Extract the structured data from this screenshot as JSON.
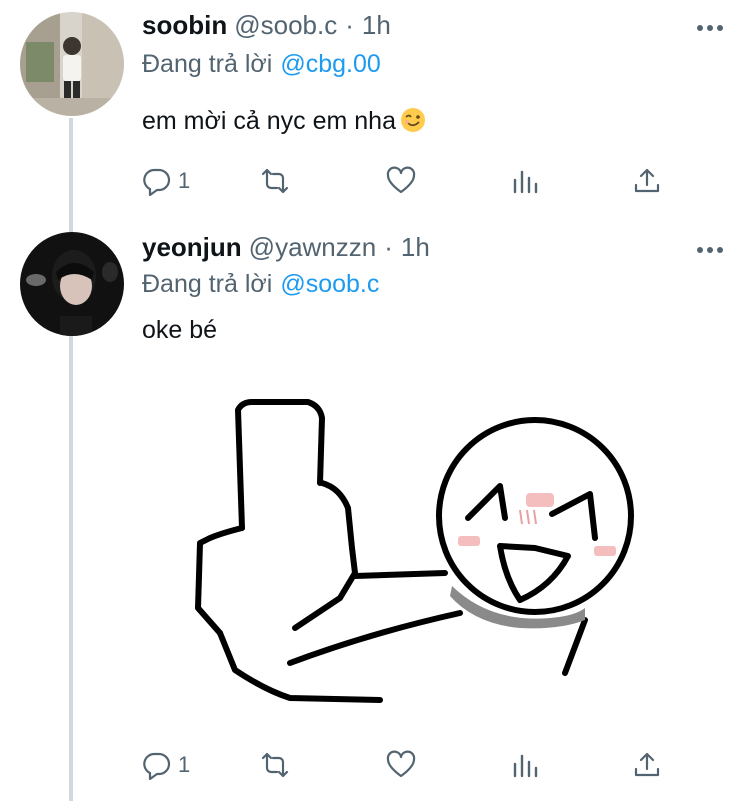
{
  "tweets": [
    {
      "name": "soobin",
      "handle": "@soob.c",
      "sep": "·",
      "time": "1h",
      "replying_prefix": "Đang trả lời",
      "replying_to": "@cbg.00",
      "text": "em mời cả nyc em nha",
      "emoji": "winking-face",
      "reply_count": "1"
    },
    {
      "name": "yeonjun",
      "handle": "@yawnzzn",
      "sep": "·",
      "time": "1h",
      "replying_prefix": "Đang trả lời",
      "replying_to": "@soob.c",
      "text": "oke bé",
      "reply_count": "1"
    }
  ],
  "colors": {
    "text": "#0f1419",
    "secondary": "#536471",
    "link": "#1d9bf0",
    "thread_line": "#cfd9de"
  }
}
